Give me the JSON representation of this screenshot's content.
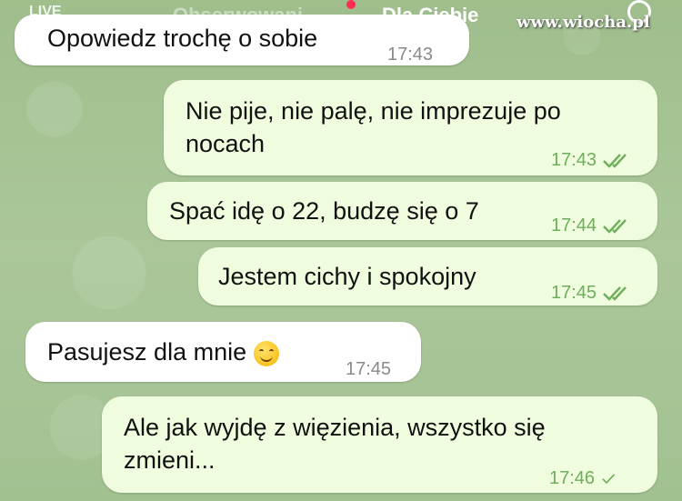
{
  "topbar": {
    "live": "LIVE",
    "tab_following": "Obserwowani",
    "tab_for_you": "Dla Ciebie"
  },
  "watermark": "www.wiocha.pl",
  "messages": [
    {
      "side": "in",
      "text": "Opowiedz trochę o sobie",
      "time": "17:43"
    },
    {
      "side": "out",
      "text": "Nie pije, nie palę, nie imprezuje po nocach",
      "time": "17:43",
      "status": "double-check-icon"
    },
    {
      "side": "out",
      "text": "Spać idę o 22, budzę się o 7",
      "time": "17:44",
      "status": "double-check-icon"
    },
    {
      "side": "out",
      "text": "Jestem cichy i spokojny",
      "time": "17:45",
      "status": "double-check-icon"
    },
    {
      "side": "in",
      "text": "Pasujesz dla mnie",
      "emoji": "smiling-face-icon",
      "time": "17:45"
    },
    {
      "side": "out",
      "text": "Ale jak wyjdę z więzienia, wszystko się zmieni...",
      "time": "17:46",
      "status": "single-check-icon"
    }
  ],
  "colors": {
    "incoming": "#ffffff",
    "outgoing": "#effdde",
    "wallpaper": "#a8c496",
    "checks": "#6fae5a"
  }
}
